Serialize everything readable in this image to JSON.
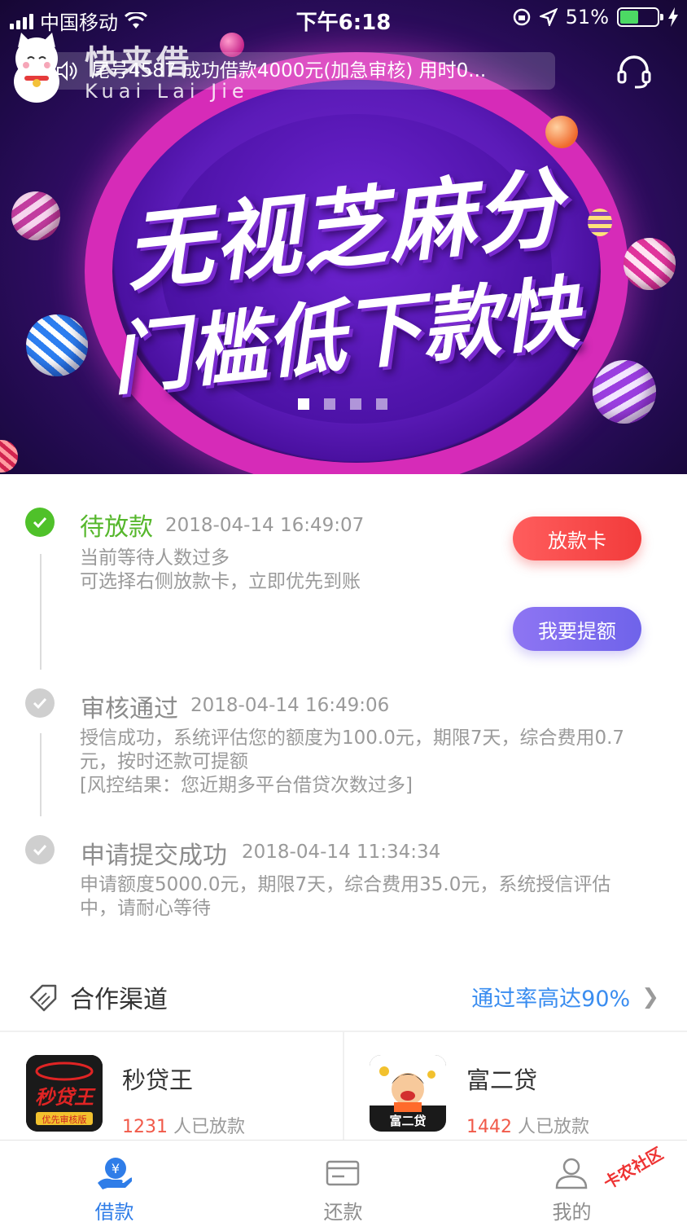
{
  "status_bar": {
    "carrier": "中国移动",
    "time": "下午6:18",
    "battery_percent": "51%",
    "battery_level": 0.51
  },
  "header": {
    "logo_text": "快来借",
    "logo_pinyin": "Kuai Lai Jie",
    "ticker_text": "尾号4587 成功借款4000元(加急审核) 用时0..."
  },
  "banner": {
    "line1": "无视芝麻分",
    "line2": "门槛低下款快",
    "dots_total": 4,
    "active_dot": 0
  },
  "timeline": {
    "steps": [
      {
        "title": "待放款",
        "time": "2018-04-14 16:49:07",
        "desc_lines": [
          "当前等待人数过多",
          "可选择右侧放款卡，立即优先到账"
        ],
        "status": "current"
      },
      {
        "title": "审核通过",
        "time": "2018-04-14 16:49:06",
        "desc_lines": [
          "授信成功，系统评估您的额度为100.0元，期限7天，综合费用0.7",
          "元，按时还款可提额",
          "[风控结果：您近期多平台借贷次数过多]"
        ],
        "status": "done"
      },
      {
        "title": "申请提交成功",
        "time": "2018-04-14 11:34:34",
        "desc_lines": [
          "申请额度5000.0元，期限7天，综合费用35.0元，系统授信评估",
          "中，请耐心等待"
        ],
        "status": "done"
      }
    ],
    "buttons": {
      "loan_card": "放款卡",
      "raise_limit": "我要提额"
    }
  },
  "partners": {
    "title": "合作渠道",
    "more_text": "通过率高达90%",
    "items": [
      {
        "name": "秒贷王",
        "count": "1231",
        "suffix": "人已放款",
        "icon_text": "秒贷王",
        "icon_sub": "优先审核版"
      },
      {
        "name": "富二贷",
        "count": "1442",
        "suffix": "人已放款",
        "icon_text": "富二贷"
      }
    ]
  },
  "tabbar": {
    "tabs": [
      {
        "label": "借款",
        "active": true
      },
      {
        "label": "还款",
        "active": false
      },
      {
        "label": "我的",
        "active": false
      }
    ]
  },
  "watermark": "卡农社区",
  "colors": {
    "accent_blue": "#2f7de8",
    "success_green": "#56b72c",
    "loan_card_red": "#f23b3b",
    "raise_purple": "#7a6bee"
  }
}
